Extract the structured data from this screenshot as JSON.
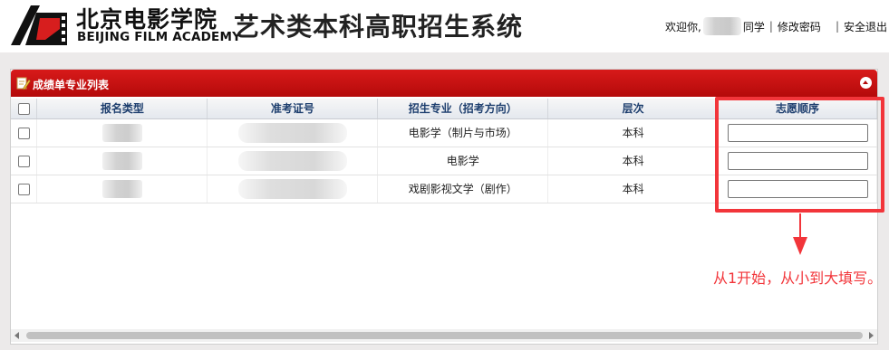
{
  "header": {
    "school_cn": "北京电影学院",
    "school_en": "BEIJING FILM ACADEMY",
    "system_title": "艺术类本科高职招生系统",
    "welcome": "欢迎你,",
    "user_suffix": "同学",
    "change_password": "修改密码",
    "logout": "安全退出",
    "separator": "|"
  },
  "panel": {
    "title": "成绩单专业列表",
    "columns": [
      "报名类型",
      "准考证号",
      "招生专业（招考方向）",
      "层次",
      "志愿顺序"
    ],
    "rows": [
      {
        "major": "电影学（制片与市场）",
        "level": "本科",
        "order": ""
      },
      {
        "major": "电影学",
        "level": "本科",
        "order": ""
      },
      {
        "major": "戏剧影视文学（剧作）",
        "level": "本科",
        "order": ""
      }
    ]
  },
  "annotation": {
    "hint": "从1开始，从小到大填写。",
    "color": "#f2353a"
  },
  "colors": {
    "panel_header": "#c41111",
    "header_text": "#1d3e6e",
    "band": "#eceaea"
  }
}
